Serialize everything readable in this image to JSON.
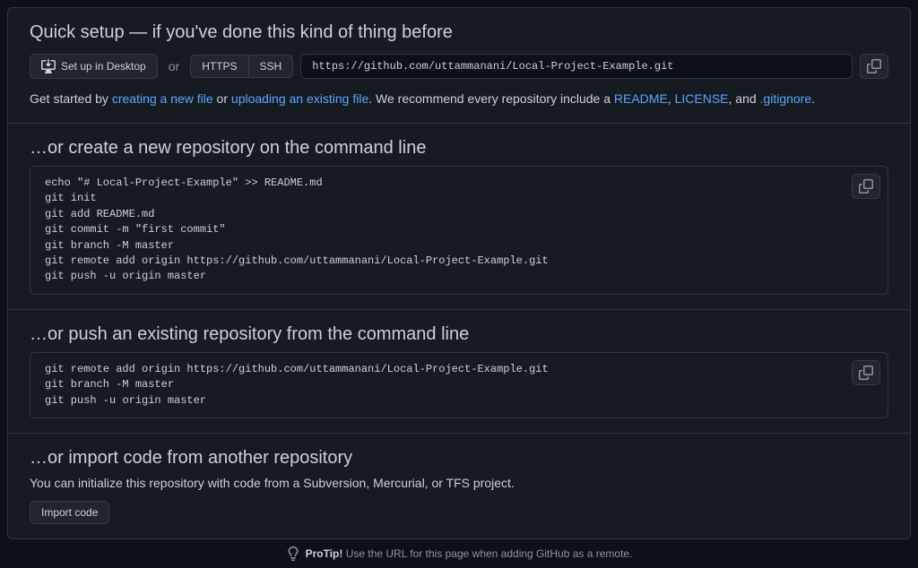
{
  "quickSetup": {
    "heading": "Quick setup — if you've done this kind of thing before",
    "desktopBtn": "Set up in Desktop",
    "or": "or",
    "httpsBtn": "HTTPS",
    "sshBtn": "SSH",
    "url": "https://github.com/uttammanani/Local-Project-Example.git",
    "helpPrefix": "Get started by ",
    "createFileLink": "creating a new file",
    "helpOr": " or ",
    "uploadLink": "uploading an existing file",
    "helpMid": ". We recommend every repository include a ",
    "readmeLink": "README",
    "comma1": ", ",
    "licenseLink": "LICENSE",
    "comma2": ", and ",
    "gitignoreLink": ".gitignore",
    "period": "."
  },
  "createRepo": {
    "heading": "…or create a new repository on the command line",
    "code": "echo \"# Local-Project-Example\" >> README.md\ngit init\ngit add README.md\ngit commit -m \"first commit\"\ngit branch -M master\ngit remote add origin https://github.com/uttammanani/Local-Project-Example.git\ngit push -u origin master"
  },
  "pushRepo": {
    "heading": "…or push an existing repository from the command line",
    "code": "git remote add origin https://github.com/uttammanani/Local-Project-Example.git\ngit branch -M master\ngit push -u origin master"
  },
  "importSection": {
    "heading": "…or import code from another repository",
    "text": "You can initialize this repository with code from a Subversion, Mercurial, or TFS project.",
    "btn": "Import code"
  },
  "protip": {
    "strong": "ProTip!",
    "text": " Use the URL for this page when adding GitHub as a remote."
  }
}
